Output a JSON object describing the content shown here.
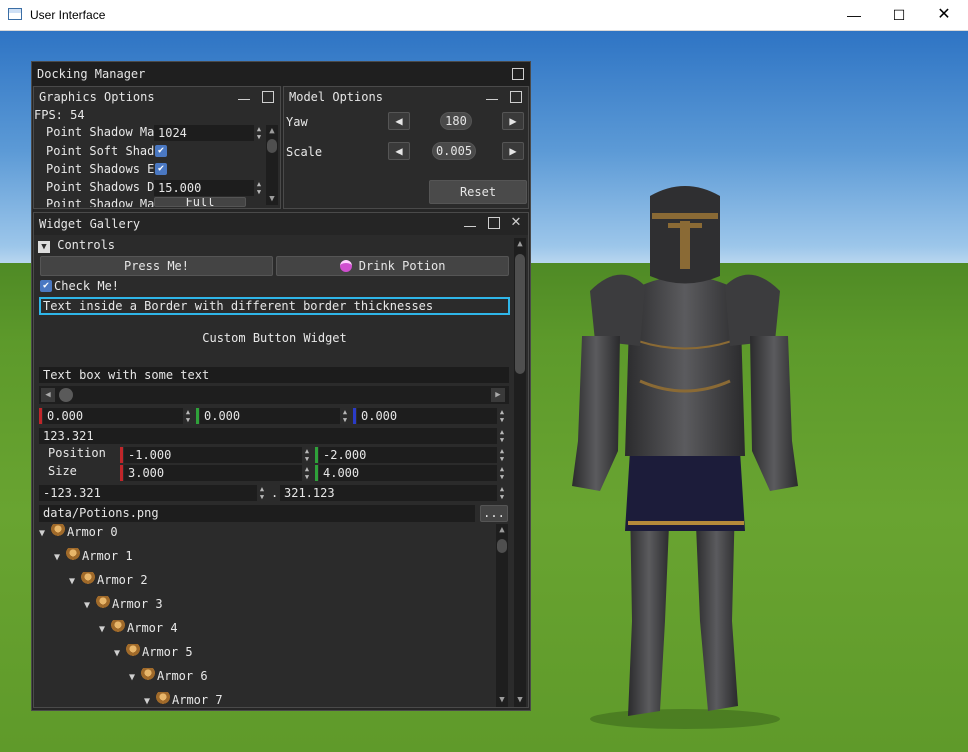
{
  "window": {
    "title": "User Interface",
    "min": "—",
    "max": "☐",
    "close": "✕"
  },
  "docking": {
    "title": "Docking Manager"
  },
  "graphics": {
    "title": "Graphics Options",
    "fps": "FPS: 54",
    "rows": [
      {
        "label": "Point Shadow Ma",
        "value": "1024"
      },
      {
        "label": "Point Soft Shad",
        "checked": "✔"
      },
      {
        "label": "Point Shadows E",
        "checked": "✔"
      },
      {
        "label": "Point Shadows D",
        "value": "15.000"
      },
      {
        "label": "Point Shadow Ma",
        "value": "Full"
      }
    ]
  },
  "model": {
    "title": "Model Options",
    "yaw": {
      "label": "Yaw",
      "value": "180"
    },
    "scale": {
      "label": "Scale",
      "value": "0.005"
    },
    "reset": "Reset"
  },
  "gallery": {
    "title": "Widget Gallery",
    "controls": "Controls",
    "press": "Press Me!",
    "drink": "Drink Potion",
    "check": "Check Me!",
    "border_text": "Text inside a Border with different border thicknesses",
    "custom": "Custom Button Widget",
    "textbox": "Text box with some text",
    "rgb": [
      "0.000",
      "0.000",
      "0.000"
    ],
    "single": "123.321",
    "position_label": "Position",
    "size_label": "Size",
    "position": [
      "-1.000",
      "-2.000"
    ],
    "size": [
      "3.000",
      "4.000"
    ],
    "pair": [
      "-123.321",
      "321.123"
    ],
    "pair_sep": ".",
    "file": "data/Potions.png",
    "browse": "...",
    "tree": [
      "Armor 0",
      "Armor 1",
      "Armor 2",
      "Armor 3",
      "Armor 4",
      "Armor 5",
      "Armor 6",
      "Armor 7"
    ]
  },
  "colors": {
    "accent": "#4a78c2",
    "red": "#c0262a",
    "green": "#2fa13a",
    "blue": "#2a3bc7",
    "cyan_border": "#2fb6e9"
  }
}
